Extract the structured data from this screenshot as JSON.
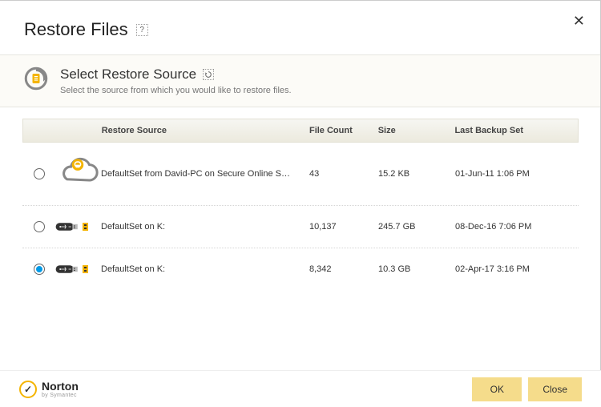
{
  "window": {
    "title": "Restore Files"
  },
  "section": {
    "title": "Select Restore Source",
    "subtitle": "Select the source from which you would like to restore files."
  },
  "columns": {
    "src": "Restore Source",
    "fc": "File Count",
    "size": "Size",
    "lb": "Last Backup Set"
  },
  "rows": [
    {
      "icon": "cloud",
      "selected": false,
      "name": "DefaultSet from David-PC on Secure Online S…",
      "file_count": "43",
      "size": "15.2 KB",
      "last": "01-Jun-11 1:06 PM"
    },
    {
      "icon": "usb",
      "selected": false,
      "name": "DefaultSet on K:",
      "file_count": "10,137",
      "size": "245.7 GB",
      "last": "08-Dec-16 7:06 PM"
    },
    {
      "icon": "usb",
      "selected": true,
      "name": "DefaultSet on K:",
      "file_count": "8,342",
      "size": "10.3 GB",
      "last": "02-Apr-17 3:16 PM"
    }
  ],
  "footer": {
    "brand": "Norton",
    "by": "by Symantec",
    "ok": "OK",
    "close": "Close"
  }
}
